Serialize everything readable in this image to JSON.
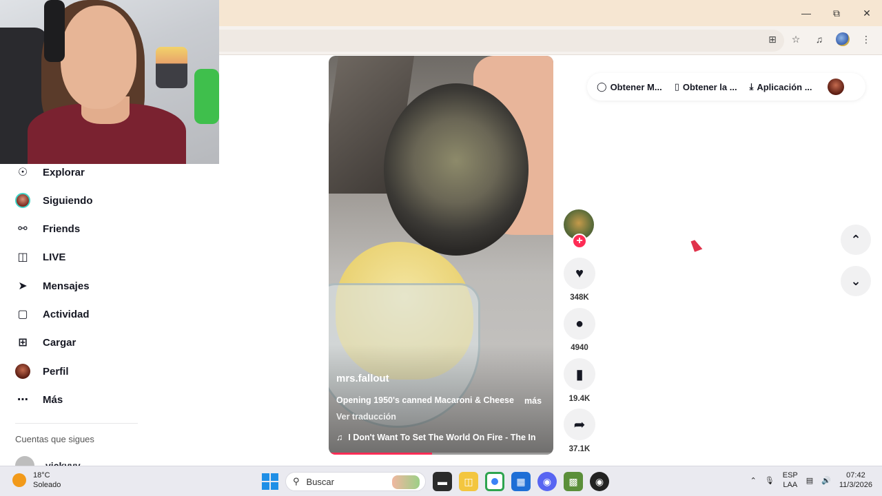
{
  "window": {
    "minimize_icon": "minimize-icon",
    "restore_icon": "restore-icon",
    "close_icon": "close-icon"
  },
  "browser": {
    "icons": [
      "install-app-icon",
      "star-icon",
      "media-queue-icon",
      "profile-icon",
      "menu-dots-icon"
    ]
  },
  "sidebar": {
    "items": [
      {
        "label": "Explorar",
        "icon": "compass-icon"
      },
      {
        "label": "Siguiendo",
        "icon": "avatar"
      },
      {
        "label": "Friends",
        "icon": "friends-icon"
      },
      {
        "label": "LIVE",
        "icon": "live-icon"
      },
      {
        "label": "Mensajes",
        "icon": "send-icon"
      },
      {
        "label": "Actividad",
        "icon": "activity-icon"
      },
      {
        "label": "Cargar",
        "icon": "upload-icon"
      },
      {
        "label": "Perfil",
        "icon": "avatar"
      },
      {
        "label": "Más",
        "icon": "more-icon"
      }
    ],
    "following_title": "Cuentas que sigues",
    "following": [
      {
        "name": "vickyvy"
      }
    ]
  },
  "topbar": {
    "items": [
      {
        "label": "Obtener M...",
        "icon": "coin-icon"
      },
      {
        "label": "Obtener la ...",
        "icon": "phone-icon"
      },
      {
        "label": "Aplicación ...",
        "icon": "download-icon"
      }
    ]
  },
  "video": {
    "author": "mrs.fallout",
    "description": "Opening 1950's canned Macaroni & Cheese",
    "more": "más",
    "translate": "Ver traducción",
    "music": "I Don't Want To Set The World On Fire - The In",
    "progress": 0.46
  },
  "actions": {
    "likes": "348K",
    "comments": "4940",
    "saves": "19.4K",
    "shares": "37.1K"
  },
  "taskbar": {
    "temp": "18°C",
    "weather": "Soleado",
    "search_placeholder": "Buscar",
    "lang1": "ESP",
    "lang2": "LAA",
    "time": "07:42",
    "date": "11/3/2026"
  },
  "colors": {
    "accent": "#fe2c55",
    "titlebar": "#f6e6d2",
    "taskbar": "#eaeaf0"
  }
}
